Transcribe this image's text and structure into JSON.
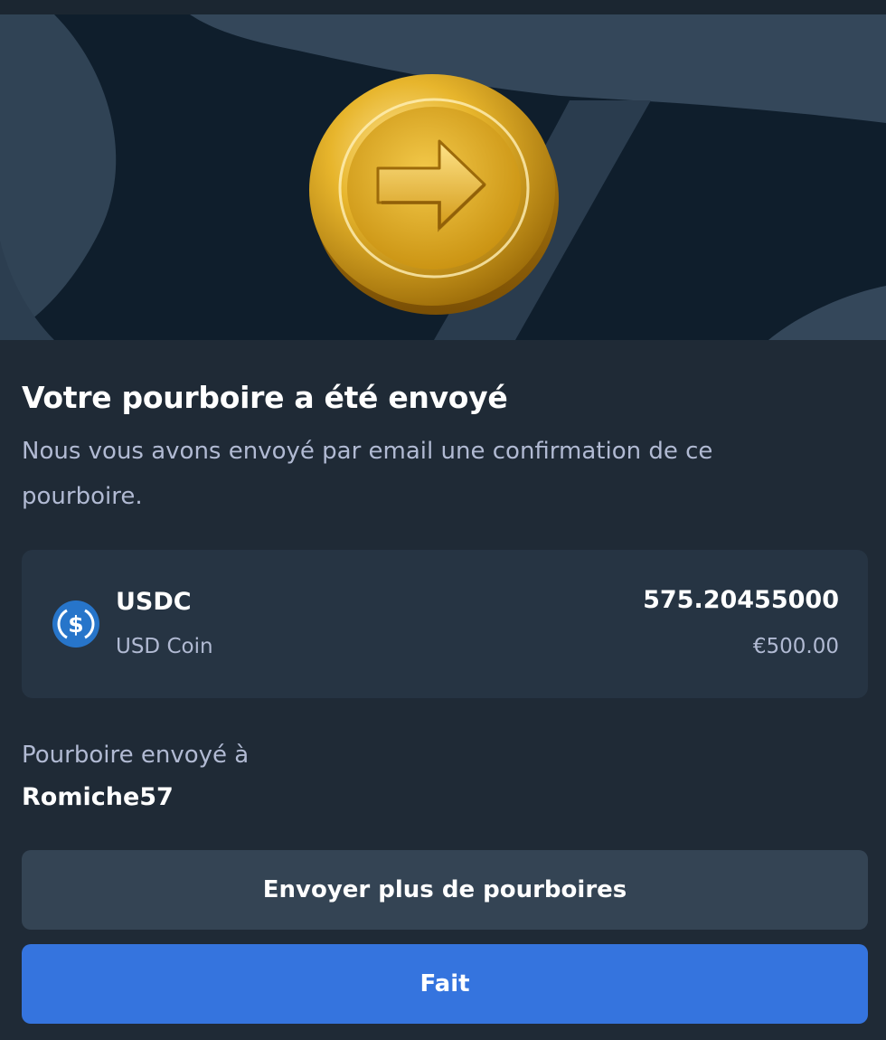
{
  "hero": {
    "image": "gold-coin-arrow-right-icon"
  },
  "confirmation": {
    "title": "Votre pourboire a été envoyé",
    "subtitle": "Nous vous avons envoyé par email une confirmation de ce pourboire."
  },
  "currency": {
    "icon": "usdc-icon",
    "code": "USDC",
    "name": "USD Coin",
    "amount": "575.20455000",
    "fiat_value": "€500.00",
    "accent_color": "#2775ca"
  },
  "recipient": {
    "label": "Pourboire envoyé à",
    "username": "Romiche57"
  },
  "actions": {
    "send_more_label": "Envoyer plus de pourboires",
    "done_label": "Fait",
    "done_color": "#3574de"
  }
}
